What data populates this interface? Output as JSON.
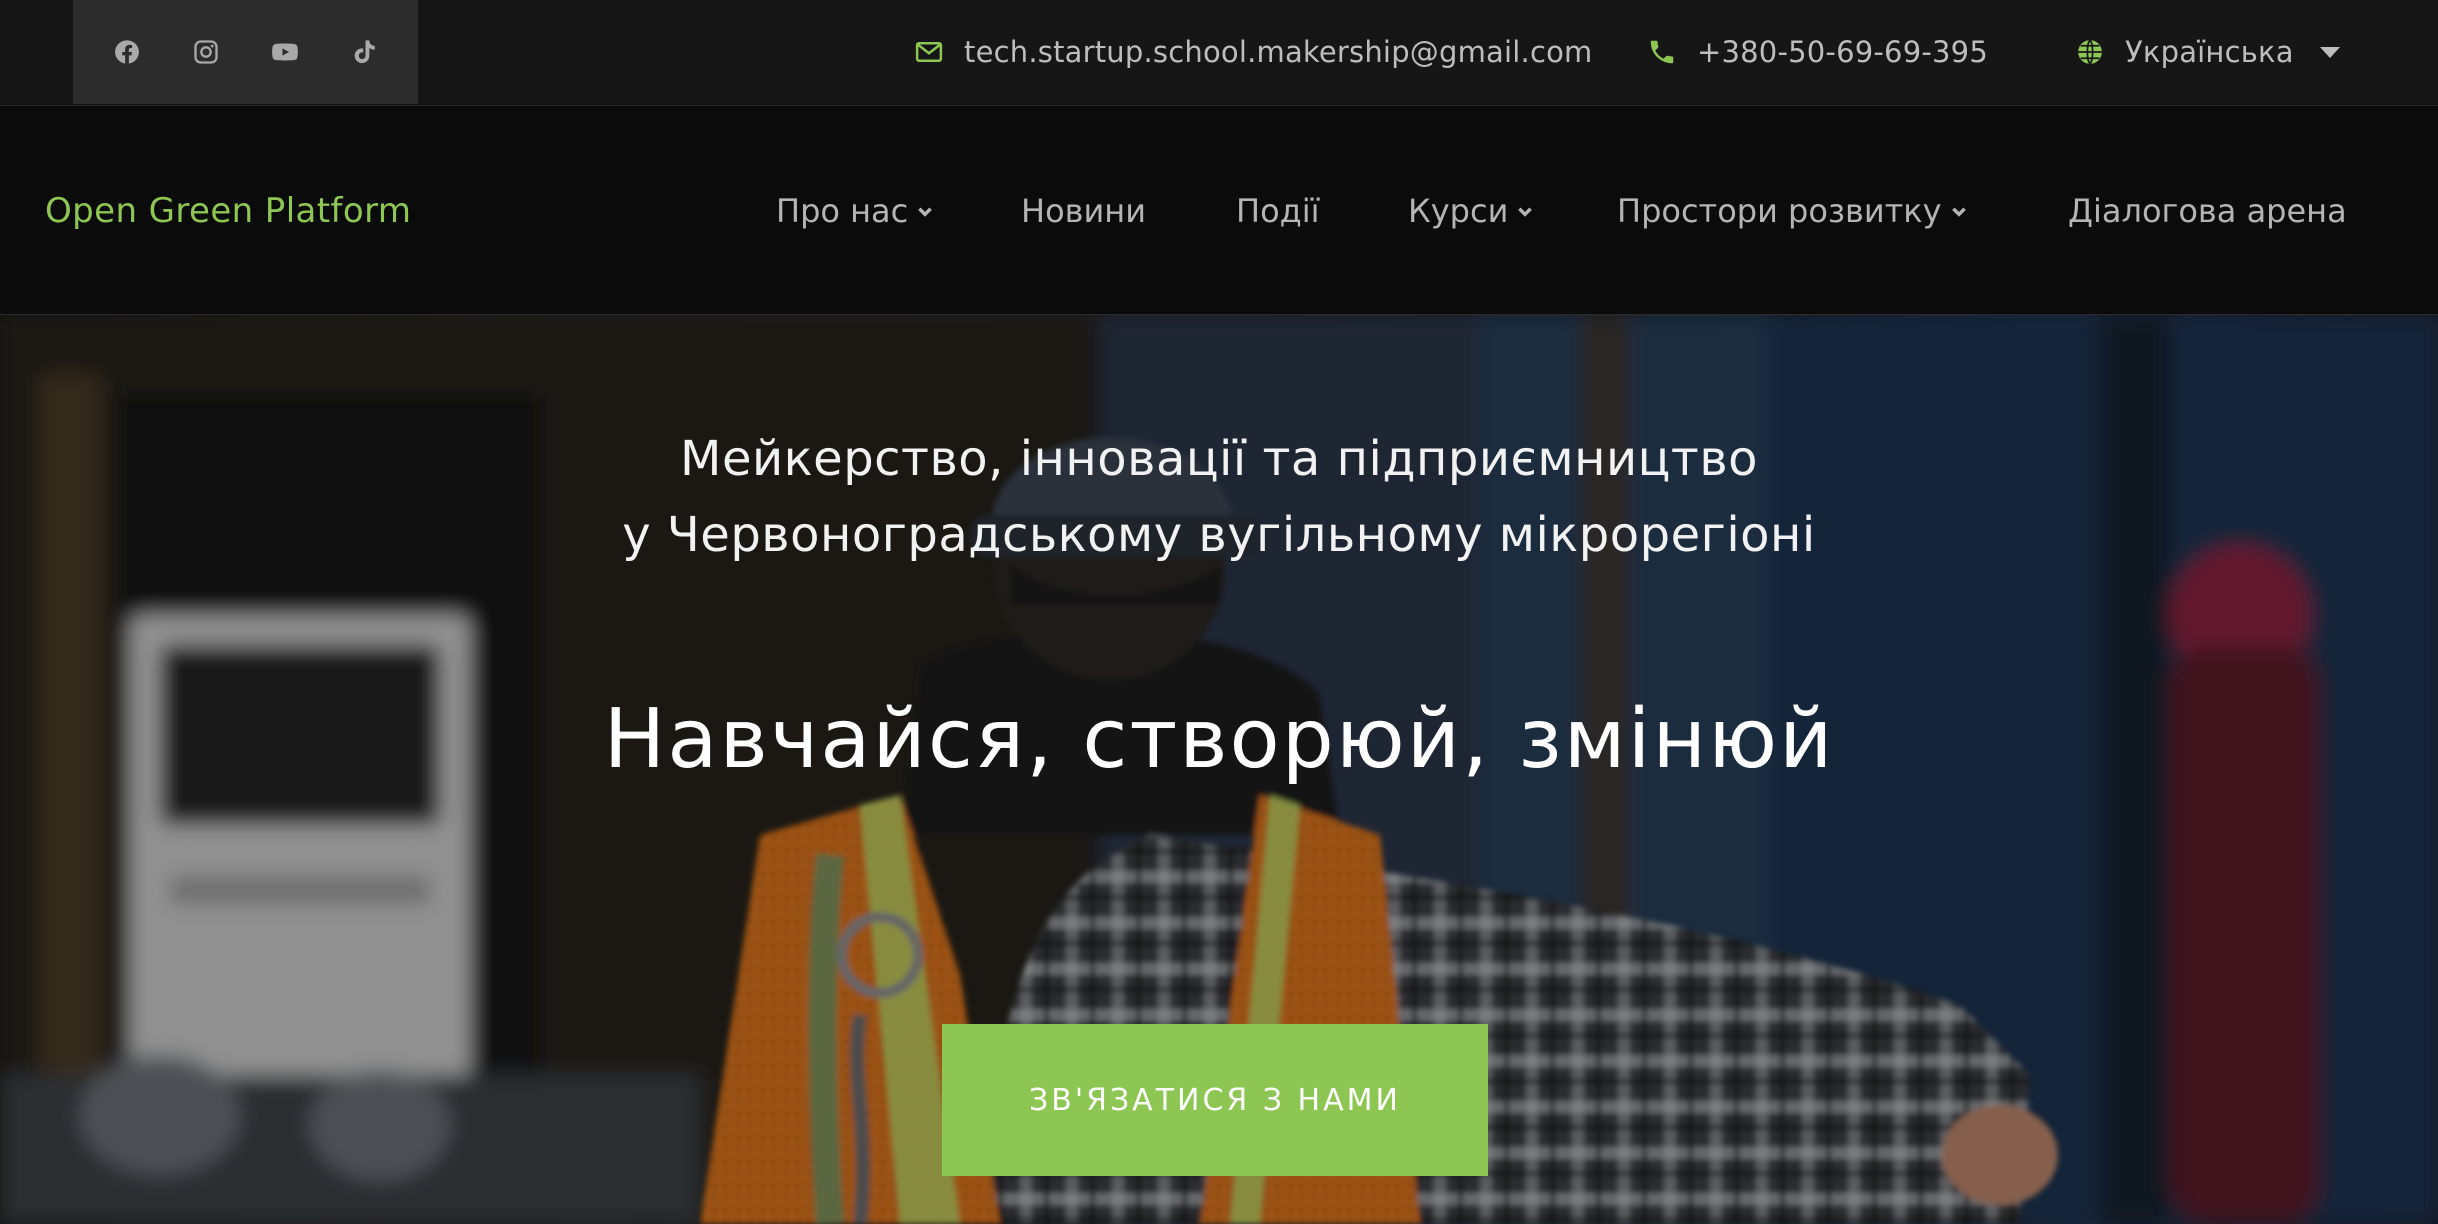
{
  "topbar": {
    "social": [
      {
        "icon": "facebook-icon"
      },
      {
        "icon": "instagram-icon"
      },
      {
        "icon": "youtube-icon"
      },
      {
        "icon": "tiktok-icon"
      }
    ],
    "email": "tech.startup.school.makership@gmail.com",
    "phone": "+380-50-69-69-395",
    "language": "Українська"
  },
  "navbar": {
    "logo": "Open Green Platform",
    "items": [
      {
        "label": "Про нас"
      },
      {
        "label": "Новини"
      },
      {
        "label": "Події"
      },
      {
        "label": "Курси"
      },
      {
        "label": "Простори розвитку"
      },
      {
        "label": "Діалогова арена"
      }
    ]
  },
  "hero": {
    "subtitle_line1": "Мейкерство, інновації та підприємництво",
    "subtitle_line2": "у Червоноградському вугільному мікрорегіоні",
    "title": "Навчайся, створюй, змінюй",
    "cta": "ЗВ'ЯЗАТИСЯ З НАМИ"
  },
  "colors": {
    "accent": "#8dc653",
    "topbar_bg": "#161616",
    "navbar_bg": "#0b0b0b",
    "social_bg": "#2c2c2c"
  }
}
